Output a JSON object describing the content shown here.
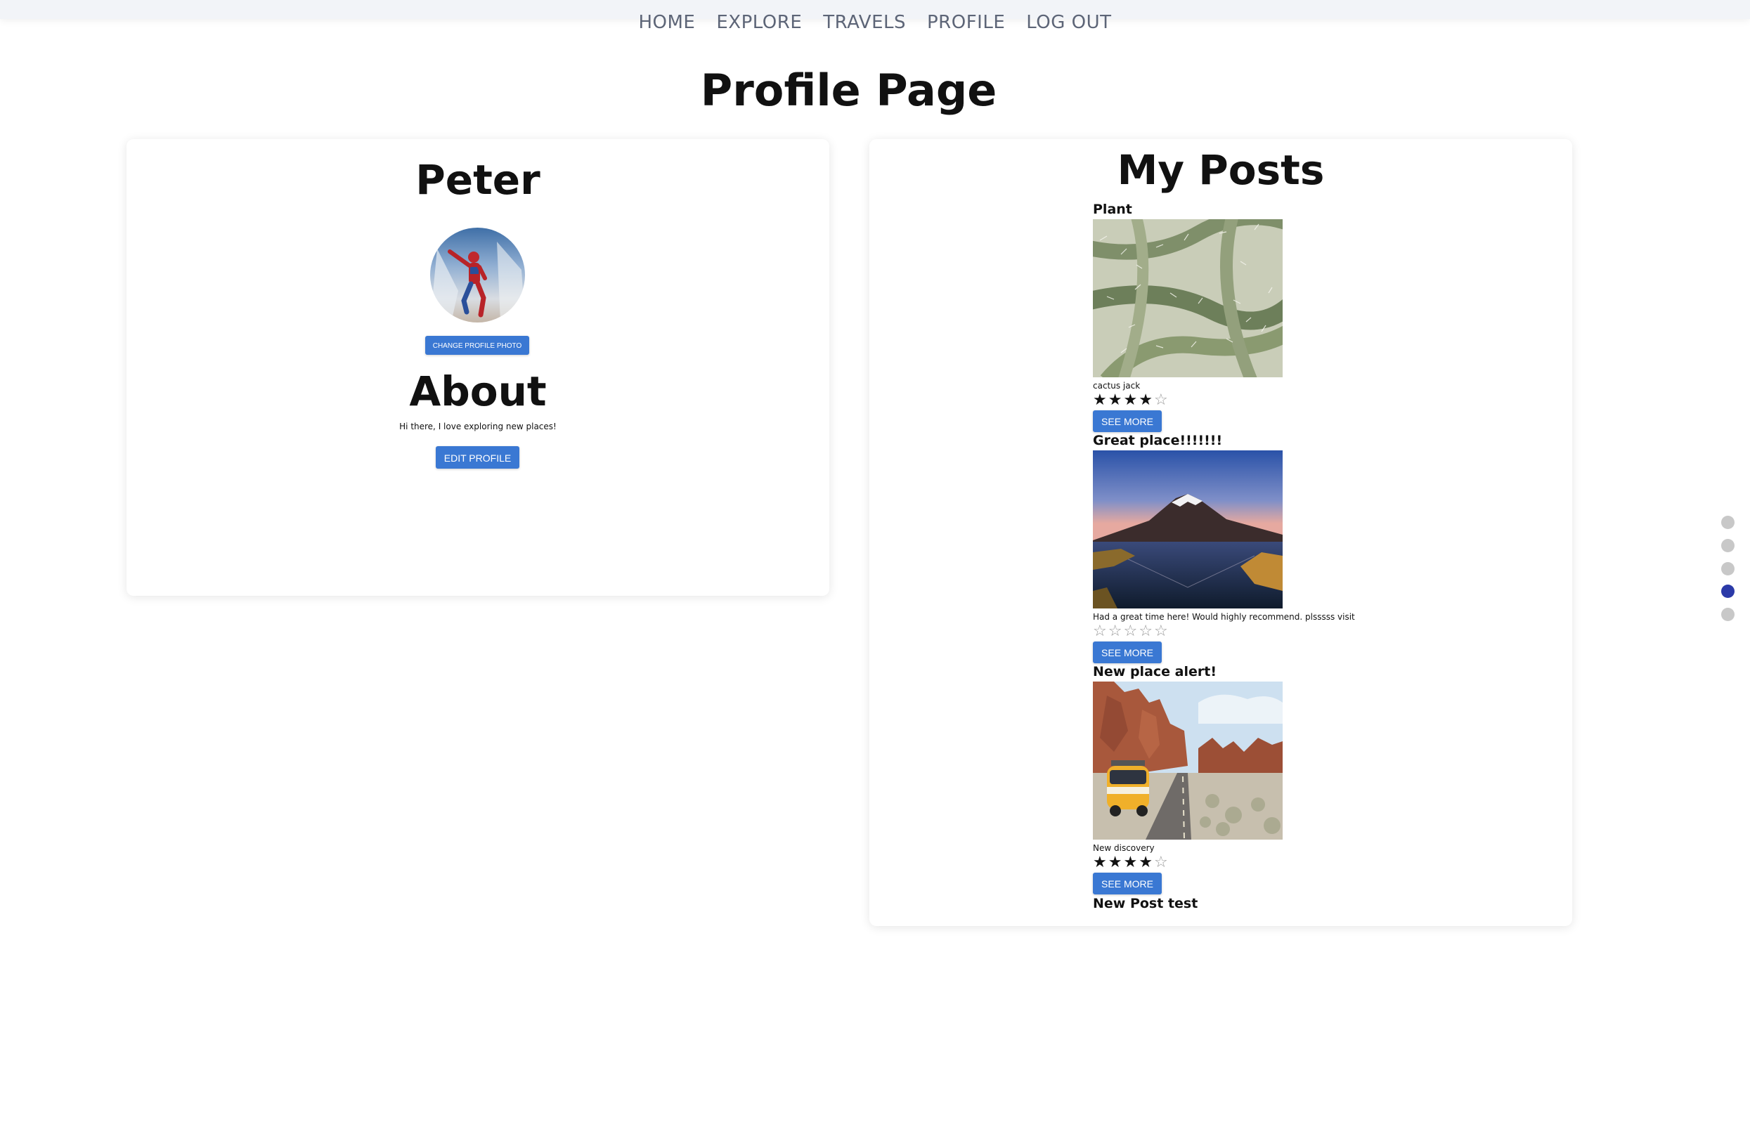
{
  "nav": {
    "links": [
      "HOME",
      "EXPLORE",
      "TRAVELS",
      "PROFILE",
      "LOG OUT"
    ]
  },
  "page": {
    "title": "Profile Page"
  },
  "profile": {
    "name": "Peter",
    "change_photo_label": "CHANGE PROFILE PHOTO",
    "about_heading": "About",
    "about_text": "Hi there, I love exploring new places!",
    "edit_label": "EDIT PROFILE"
  },
  "posts": {
    "heading": "My Posts",
    "see_more_label": "SEE MORE",
    "items": [
      {
        "title": "Plant",
        "description": "cactus jack",
        "rating": 4,
        "max_rating": 5,
        "image": "cactus-photo"
      },
      {
        "title": "Great place!!!!!!!",
        "description": "Had a great time here! Would highly recommend. plsssss visit",
        "rating": 0,
        "max_rating": 5,
        "image": "mountain-lake-photo"
      },
      {
        "title": "New place alert!",
        "description": "New discovery",
        "rating": 4,
        "max_rating": 5,
        "image": "desert-road-van-photo"
      },
      {
        "title": "New Post test",
        "description": "",
        "rating": 0,
        "max_rating": 5,
        "image": ""
      }
    ]
  },
  "pager": {
    "count": 5,
    "active_index": 3
  },
  "colors": {
    "accent": "#3a78d3",
    "nav_bg": "#f2f4f8",
    "nav_text": "#5d6577",
    "dot_active": "#2b3aa8",
    "dot_inactive": "#c8c8c8"
  }
}
